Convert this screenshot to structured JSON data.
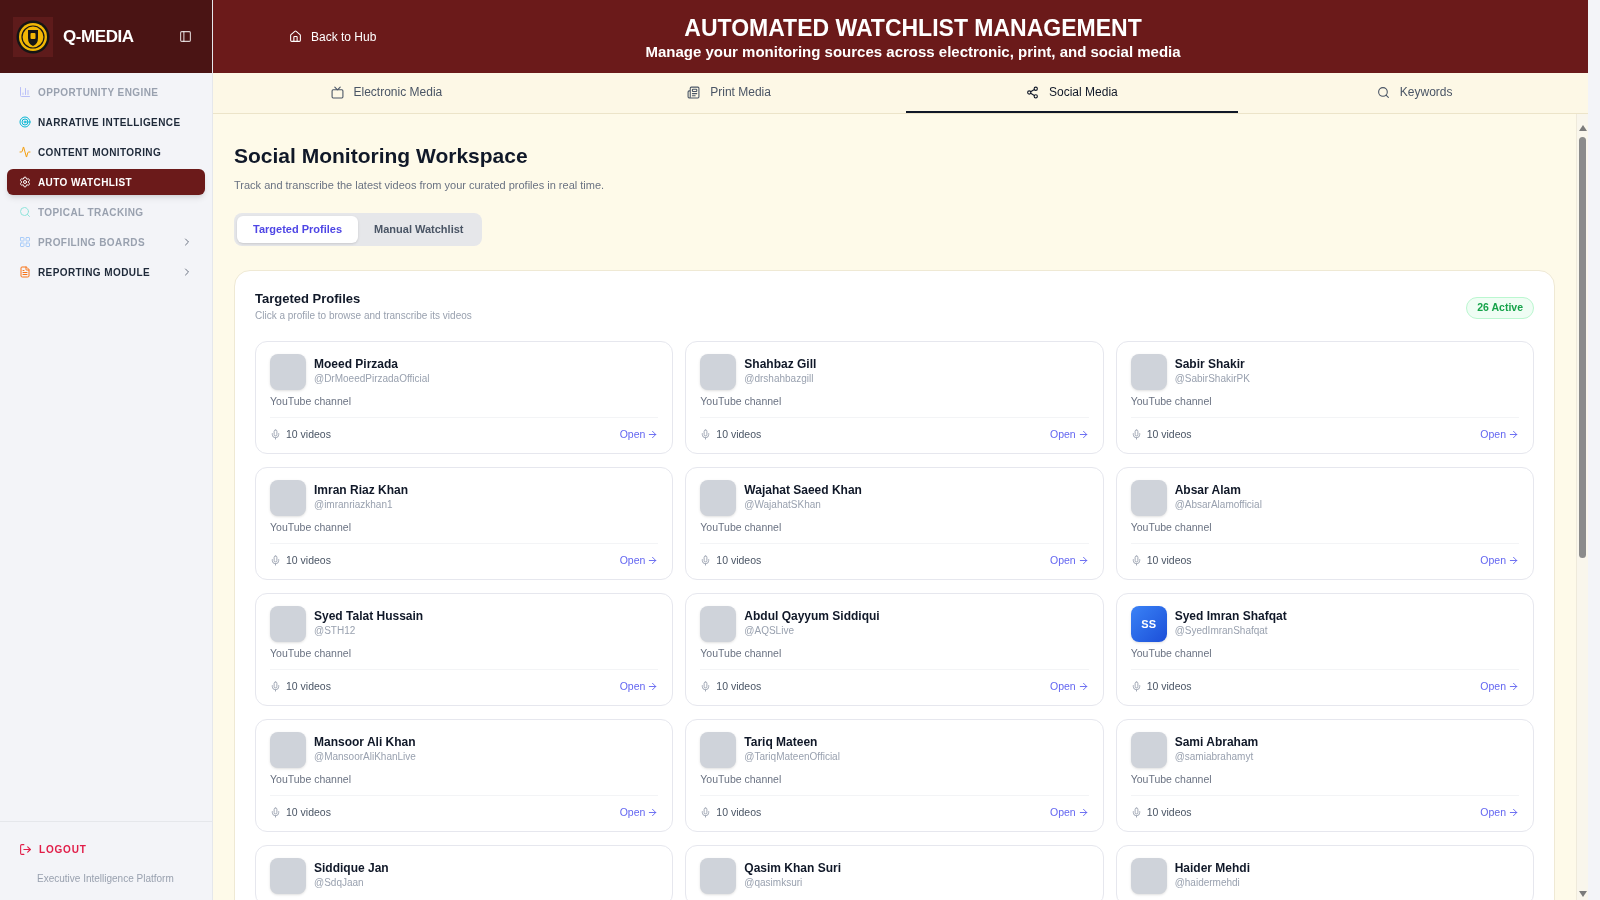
{
  "sidebar": {
    "brand": "Q-MEDIA",
    "items": [
      {
        "label": "OPPORTUNITY ENGINE",
        "selected": false,
        "disabled": true,
        "expandable": false
      },
      {
        "label": "NARRATIVE INTELLIGENCE",
        "selected": false,
        "disabled": false,
        "expandable": false
      },
      {
        "label": "CONTENT MONITORING",
        "selected": false,
        "disabled": false,
        "expandable": false
      },
      {
        "label": "AUTO WATCHLIST",
        "selected": true,
        "disabled": false,
        "expandable": false
      },
      {
        "label": "TOPICAL TRACKING",
        "selected": false,
        "disabled": true,
        "expandable": false
      },
      {
        "label": "PROFILING BOARDS",
        "selected": false,
        "disabled": true,
        "expandable": true
      },
      {
        "label": "REPORTING MODULE",
        "selected": false,
        "disabled": false,
        "expandable": true
      }
    ],
    "logout": "LOGOUT",
    "footer": "Executive Intelligence Platform"
  },
  "header": {
    "back_link": "Back to Hub",
    "title": "AUTOMATED WATCHLIST MANAGEMENT",
    "subtitle": "Manage your monitoring sources across electronic, print, and social media"
  },
  "tabs": [
    {
      "label": "Electronic Media",
      "selected": false
    },
    {
      "label": "Print Media",
      "selected": false
    },
    {
      "label": "Social Media",
      "selected": true
    },
    {
      "label": "Keywords",
      "selected": false
    }
  ],
  "workspace": {
    "title": "Social Monitoring Workspace",
    "description": "Track and transcribe the latest videos from your curated profiles in real time.",
    "segments": [
      {
        "label": "Targeted Profiles",
        "selected": true
      },
      {
        "label": "Manual Watchlist",
        "selected": false
      }
    ]
  },
  "panel": {
    "title": "Targeted Profiles",
    "subtitle": "Click a profile to browse and transcribe its videos",
    "badge": "26 Active",
    "profiles": [
      {
        "name": "Moeed Pirzada",
        "handle": "@DrMoeedPirzadaOfficial",
        "avatar": {
          "kind": "photo"
        },
        "source": "YouTube channel",
        "videos": "10 videos",
        "action": "Open"
      },
      {
        "name": "Shahbaz Gill",
        "handle": "@drshahbazgill",
        "avatar": {
          "kind": "photo"
        },
        "source": "YouTube channel",
        "videos": "10 videos",
        "action": "Open"
      },
      {
        "name": "Sabir Shakir",
        "handle": "@SabirShakirPK",
        "avatar": {
          "kind": "photo"
        },
        "source": "YouTube channel",
        "videos": "10 videos",
        "action": "Open"
      },
      {
        "name": "Imran Riaz Khan",
        "handle": "@imranriazkhan1",
        "avatar": {
          "kind": "photo"
        },
        "source": "YouTube channel",
        "videos": "10 videos",
        "action": "Open"
      },
      {
        "name": "Wajahat Saeed Khan",
        "handle": "@WajahatSKhan",
        "avatar": {
          "kind": "photo"
        },
        "source": "YouTube channel",
        "videos": "10 videos",
        "action": "Open"
      },
      {
        "name": "Absar Alam",
        "handle": "@AbsarAlamofficial",
        "avatar": {
          "kind": "photo"
        },
        "source": "YouTube channel",
        "videos": "10 videos",
        "action": "Open"
      },
      {
        "name": "Syed Talat Hussain",
        "handle": "@STH12",
        "avatar": {
          "kind": "photo"
        },
        "source": "YouTube channel",
        "videos": "10 videos",
        "action": "Open"
      },
      {
        "name": "Abdul Qayyum Siddiqui",
        "handle": "@AQSLive",
        "avatar": {
          "kind": "photo"
        },
        "source": "YouTube channel",
        "videos": "10 videos",
        "action": "Open"
      },
      {
        "name": "Syed Imran Shafqat",
        "handle": "@SyedImranShafqat",
        "avatar": {
          "kind": "initials",
          "text": "SS"
        },
        "source": "YouTube channel",
        "videos": "10 videos",
        "action": "Open"
      },
      {
        "name": "Mansoor Ali Khan",
        "handle": "@MansoorAliKhanLive",
        "avatar": {
          "kind": "photo"
        },
        "source": "YouTube channel",
        "videos": "10 videos",
        "action": "Open"
      },
      {
        "name": "Tariq Mateen",
        "handle": "@TariqMateenOfficial",
        "avatar": {
          "kind": "photo"
        },
        "source": "YouTube channel",
        "videos": "10 videos",
        "action": "Open"
      },
      {
        "name": "Sami Abraham",
        "handle": "@samiabrahamyt",
        "avatar": {
          "kind": "photo"
        },
        "source": "YouTube channel",
        "videos": "10 videos",
        "action": "Open"
      },
      {
        "name": "Siddique Jan",
        "handle": "@SdqJaan",
        "avatar": {
          "kind": "photo"
        }
      },
      {
        "name": "Qasim Khan Suri",
        "handle": "@qasimksuri",
        "avatar": {
          "kind": "photo"
        }
      },
      {
        "name": "Haider Mehdi",
        "handle": "@haidermehdi",
        "avatar": {
          "kind": "photo"
        }
      }
    ]
  }
}
